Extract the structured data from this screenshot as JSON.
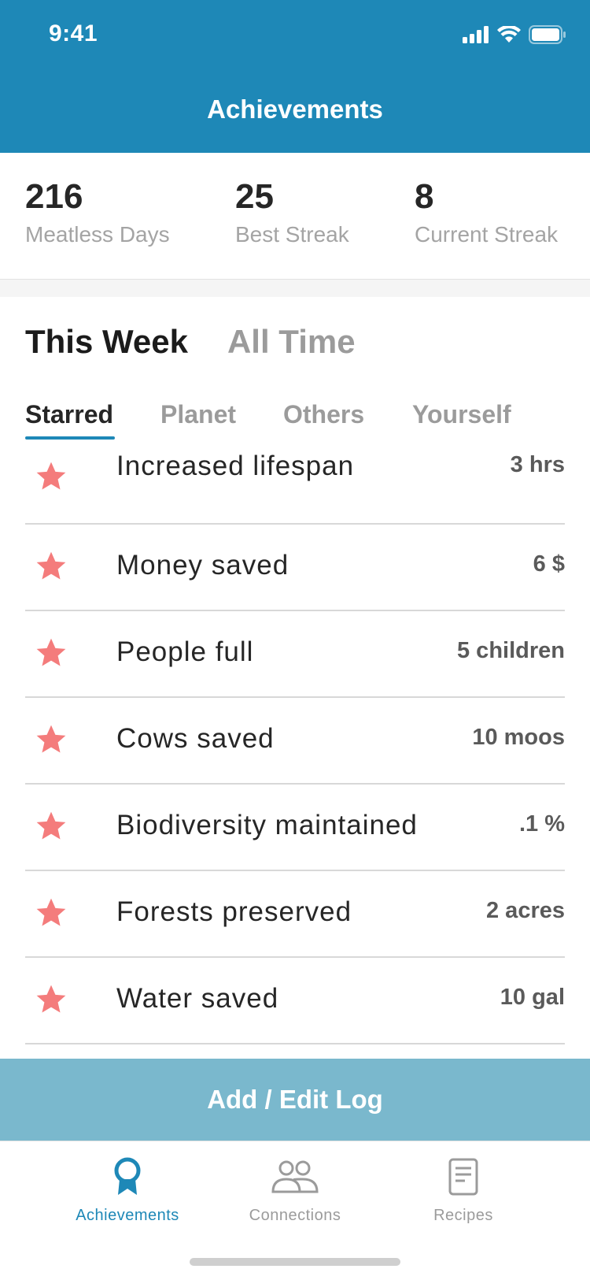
{
  "status_bar": {
    "time": "9:41"
  },
  "header": {
    "title": "Achievements"
  },
  "stats": [
    {
      "value": "216",
      "label": "Meatless Days"
    },
    {
      "value": "25",
      "label": "Best Streak"
    },
    {
      "value": "8",
      "label": "Current Streak"
    }
  ],
  "time_tabs": [
    {
      "label": "This Week",
      "active": true
    },
    {
      "label": "All Time",
      "active": false
    }
  ],
  "category_tabs": [
    {
      "label": "Starred",
      "active": true
    },
    {
      "label": "Planet",
      "active": false
    },
    {
      "label": "Others",
      "active": false
    },
    {
      "label": "Yourself",
      "active": false
    }
  ],
  "achievements": [
    {
      "label": "Increased lifespan",
      "value": "3 hrs",
      "icon": "star-icon"
    },
    {
      "label": "Money saved",
      "value": "6 $",
      "icon": "star-icon"
    },
    {
      "label": "People full",
      "value": "5 children",
      "icon": "star-icon"
    },
    {
      "label": "Cows saved",
      "value": "10 moos",
      "icon": "star-icon"
    },
    {
      "label": "Biodiversity maintained",
      "value": ".1 %",
      "icon": "star-icon"
    },
    {
      "label": "Forests preserved",
      "value": "2 acres",
      "icon": "star-icon"
    },
    {
      "label": "Water saved",
      "value": "10 gal",
      "icon": "star-icon"
    }
  ],
  "action_button": {
    "label": "Add / Edit Log"
  },
  "bottom_nav": [
    {
      "label": "Achievements",
      "icon": "ribbon-icon",
      "active": true
    },
    {
      "label": "Connections",
      "icon": "people-icon",
      "active": false
    },
    {
      "label": "Recipes",
      "icon": "document-icon",
      "active": false
    }
  ],
  "colors": {
    "primary": "#1E88B7",
    "button": "#7AB8CD",
    "star": "#F47C7C"
  }
}
